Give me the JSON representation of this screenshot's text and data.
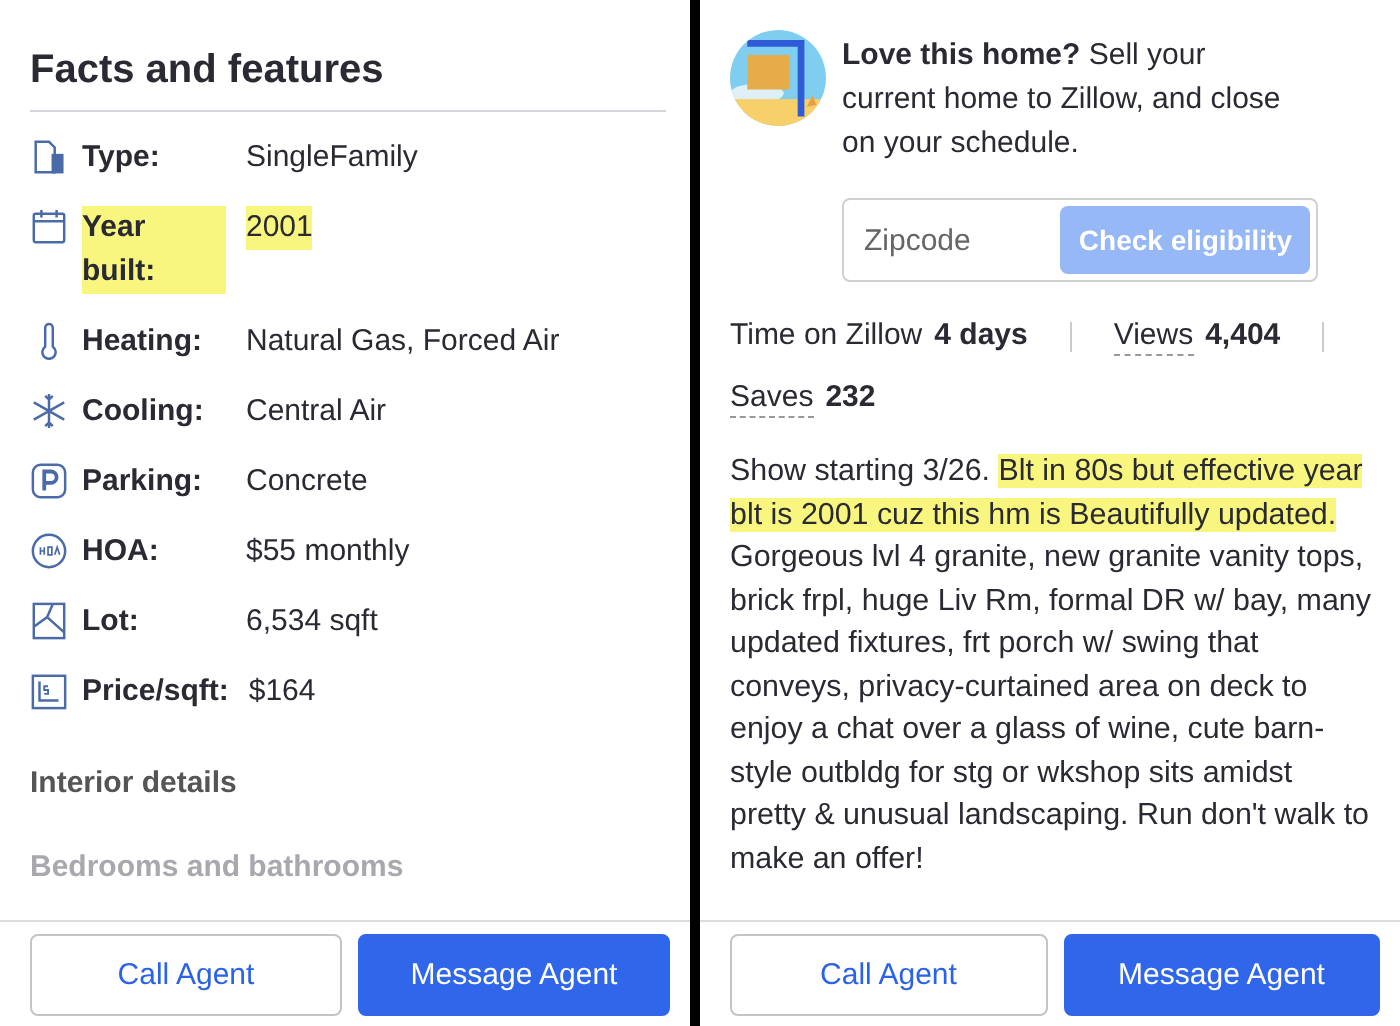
{
  "left_panel": {
    "title": "Facts and features",
    "facts": [
      {
        "kind": "type",
        "label": "Type:",
        "value": "SingleFamily",
        "highlighted": false
      },
      {
        "kind": "calendar",
        "label": "Year built:",
        "value": "2001",
        "highlighted": true
      },
      {
        "kind": "thermometer",
        "label": "Heating:",
        "value": "Natural Gas, Forced Air",
        "highlighted": false
      },
      {
        "kind": "snowflake",
        "label": "Cooling:",
        "value": "Central Air",
        "highlighted": false
      },
      {
        "kind": "parking",
        "label": "Parking:",
        "value": "Concrete",
        "highlighted": false
      },
      {
        "kind": "hoa",
        "label": "HOA:",
        "value": "$55 monthly",
        "highlighted": false
      },
      {
        "kind": "lot",
        "label": "Lot:",
        "value": "6,534 sqft",
        "highlighted": false
      },
      {
        "kind": "price",
        "label": "Price/sqft:",
        "value": "$164",
        "highlighted": false
      }
    ],
    "section_heading": "Interior details",
    "subsection_heading": "Bedrooms and bathrooms",
    "buttons": [
      {
        "label": "Call Agent",
        "kind": "secondary"
      },
      {
        "label": "Message Agent",
        "kind": "primary"
      }
    ]
  },
  "right_panel": {
    "promo": {
      "text": "**Love this home?** Sell your current home to Zillow, and close on your schedule.",
      "zipcode": {
        "placeholder": "Zipcode"
      },
      "button": "Check eligibility"
    },
    "stats": [
      {
        "label": "Time on Zillow",
        "value": "4 days",
        "underlined": false
      },
      {
        "label": "Views",
        "value": "4,404",
        "underlined": true
      },
      {
        "label": "Saves",
        "value": "232",
        "underlined": true
      }
    ],
    "description": [
      {
        "text": "Show starting 3/26. ",
        "highlighted": false
      },
      {
        "text": "Blt in 80s but effective year blt is 2001 cuz this hm is Beautifully updated.",
        "highlighted": true
      },
      {
        "text": " Gorgeous lvl 4 granite, new granite vanity tops, brick frpl, huge Liv Rm, formal DR w/ bay, many updated fixtures, frt porch w/ swing that conveys, privacy-curtained area on deck to enjoy a chat over a glass of wine, cute barn-style outbldg for stg or wkshop sits amidst pretty & unusual landscaping.  Run don't walk to make an offer!",
        "highlighted": false
      }
    ],
    "buttons": [
      {
        "label": "Call Agent",
        "kind": "secondary"
      },
      {
        "label": "Message Agent",
        "kind": "primary"
      }
    ]
  }
}
